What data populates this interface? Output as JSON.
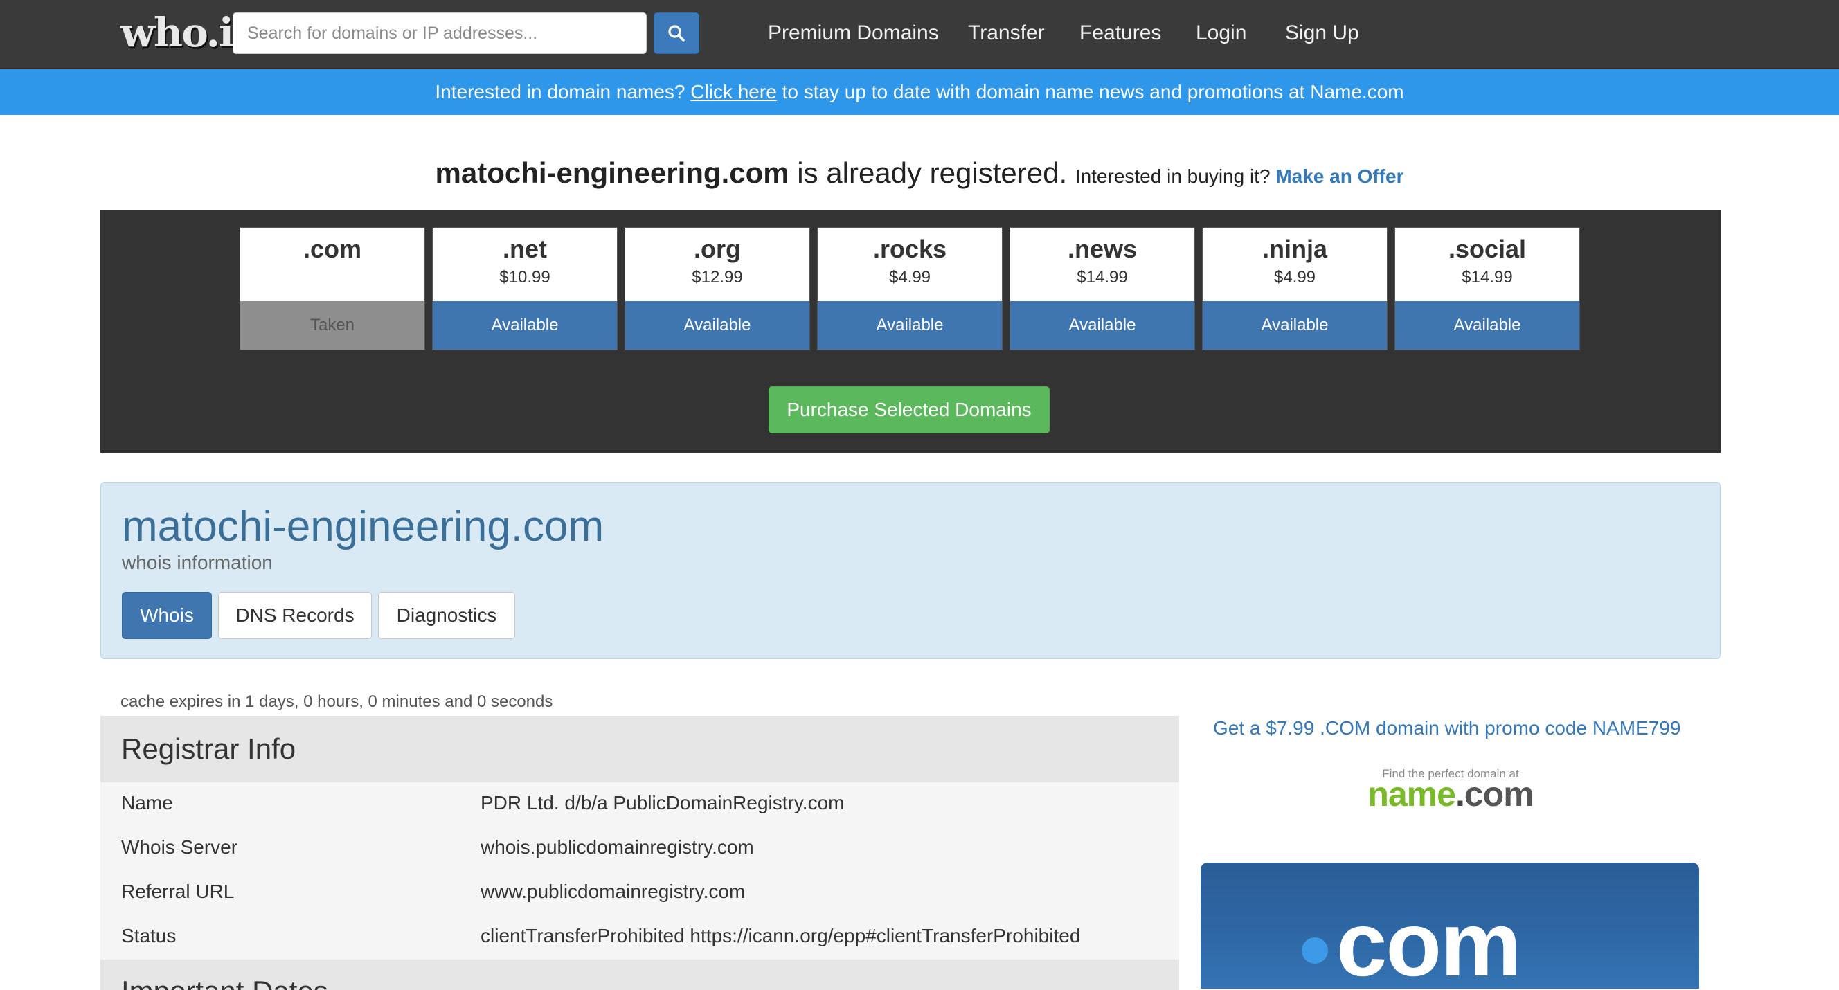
{
  "nav": {
    "logo": "who.is",
    "search_placeholder": "Search for domains or IP addresses...",
    "links": [
      "Premium Domains",
      "Transfer",
      "Features",
      "Login",
      "Sign Up"
    ]
  },
  "banner": {
    "prefix": "Interested in domain names? ",
    "link": "Click here",
    "suffix": " to stay up to date with domain name news and promotions at Name.com"
  },
  "headline": {
    "domain": "matochi-engineering.com",
    "registered": " is already registered. ",
    "buy_prompt": "Interested in buying it? ",
    "offer_link": "Make an Offer"
  },
  "tlds": [
    {
      "name": ".com",
      "price": "",
      "status": "Taken"
    },
    {
      "name": ".net",
      "price": "$10.99",
      "status": "Available"
    },
    {
      "name": ".org",
      "price": "$12.99",
      "status": "Available"
    },
    {
      "name": ".rocks",
      "price": "$4.99",
      "status": "Available"
    },
    {
      "name": ".news",
      "price": "$14.99",
      "status": "Available"
    },
    {
      "name": ".ninja",
      "price": "$4.99",
      "status": "Available"
    },
    {
      "name": ".social",
      "price": "$14.99",
      "status": "Available"
    }
  ],
  "purchase_button": "Purchase Selected Domains",
  "whois": {
    "title": "matochi-engineering.com",
    "subtitle": "whois information",
    "tabs": [
      "Whois",
      "DNS Records",
      "Diagnostics"
    ],
    "active_tab": "Whois"
  },
  "cache_note": "cache expires in 1 days, 0 hours, 0 minutes and 0 seconds",
  "registrar": {
    "heading": "Registrar Info",
    "rows": [
      {
        "key": "Name",
        "value": "PDR Ltd. d/b/a PublicDomainRegistry.com"
      },
      {
        "key": "Whois Server",
        "value": "whois.publicdomainregistry.com"
      },
      {
        "key": "Referral URL",
        "value": "www.publicdomainregistry.com"
      },
      {
        "key": "Status",
        "value": "clientTransferProhibited https://icann.org/epp#clientTransferProhibited"
      }
    ],
    "next_heading": "Important Dates"
  },
  "sidebar": {
    "promo": "Get a $7.99 .COM domain with promo code NAME799",
    "namecom_tagline": "Find the perfect domain at",
    "namecom_logo_name": "name",
    "namecom_logo_dot": ".",
    "namecom_logo_com": "com",
    "ad_text": "com"
  },
  "colors": {
    "navbar": "#3a3a3a",
    "banner": "#2f97ea",
    "primary": "#3f76b0",
    "success": "#5cb85c",
    "taken": "#8e8e8e",
    "whois_box": "#d9eaf5"
  }
}
